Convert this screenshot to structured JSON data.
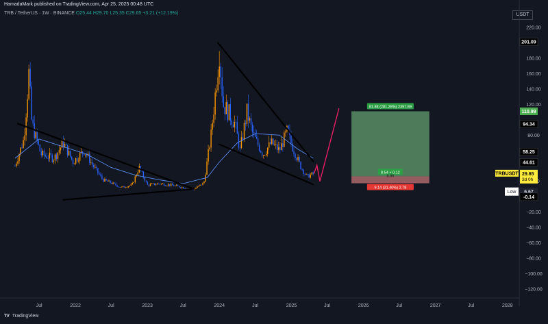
{
  "header": {
    "publish_line": "HamadaMark published on TradingView.com, Apr 25, 2025 00:48 UTC",
    "symbol": "TRB / TetherUS · 1W · BINANCE",
    "ohlc": "O25.44 H29.70 L25.35 C29.65 +3.21 (+12.19%)",
    "unit": "USDT"
  },
  "footer": {
    "logo_icon": "tradingview-logo-icon",
    "brand": "TradingView"
  },
  "colors": {
    "background": "#131722",
    "up_candle": "#ff9800",
    "down_candle": "#2962ff",
    "moving_average": "#5b8cf0",
    "trend_lines": "#000000",
    "projection": "#e91e63",
    "profit_zone": "#7fcf8a",
    "loss_zone": "#f08a8a"
  },
  "chart_data": {
    "type": "candlestick",
    "y_axis": {
      "min": -120,
      "max": 220,
      "ticks": [
        220,
        200,
        180,
        160,
        140,
        120,
        100,
        80,
        60,
        40,
        20,
        0,
        -20,
        -40,
        -60,
        -80,
        -100,
        -120
      ],
      "tick_labels": [
        "220.00",
        "",
        "180.00",
        "160.00",
        "140.00",
        "120.00",
        "",
        "80.00",
        "",
        "",
        "20.00",
        "",
        "−20.00",
        "−40.00",
        "−60.00",
        "−80.00",
        "−100.00",
        "−120.00"
      ]
    },
    "x_axis": {
      "labels": [
        {
          "text": "Jul",
          "date": "2021-07-01"
        },
        {
          "text": "2022",
          "date": "2022-01-01"
        },
        {
          "text": "Jul",
          "date": "2022-07-01"
        },
        {
          "text": "2023",
          "date": "2023-01-01"
        },
        {
          "text": "Jul",
          "date": "2023-07-01"
        },
        {
          "text": "2024",
          "date": "2024-01-01"
        },
        {
          "text": "Jul",
          "date": "2024-07-01"
        },
        {
          "text": "2025",
          "date": "2025-01-01"
        },
        {
          "text": "Jul",
          "date": "2025-07-01"
        },
        {
          "text": "2026",
          "date": "2026-01-01"
        },
        {
          "text": "Jul",
          "date": "2026-07-01"
        },
        {
          "text": "2027",
          "date": "2027-01-01"
        },
        {
          "text": "Jul",
          "date": "2027-07-01"
        },
        {
          "text": "2028",
          "date": "2028-01-01"
        }
      ]
    },
    "price_path": [
      [
        "2021-03-01",
        40
      ],
      [
        "2021-04-15",
        75
      ],
      [
        "2021-05-10",
        160
      ],
      [
        "2021-05-25",
        95
      ],
      [
        "2021-07-10",
        55
      ],
      [
        "2021-09-15",
        50
      ],
      [
        "2021-11-01",
        70
      ],
      [
        "2021-12-20",
        45
      ],
      [
        "2022-02-15",
        60
      ],
      [
        "2022-04-01",
        40
      ],
      [
        "2022-05-20",
        22
      ],
      [
        "2022-07-01",
        18
      ],
      [
        "2022-08-20",
        12
      ],
      [
        "2022-10-15",
        15
      ],
      [
        "2022-11-20",
        38
      ],
      [
        "2023-01-01",
        15
      ],
      [
        "2023-03-01",
        17
      ],
      [
        "2023-05-01",
        15
      ],
      [
        "2023-07-01",
        12
      ],
      [
        "2023-08-20",
        9
      ],
      [
        "2023-10-15",
        18
      ],
      [
        "2023-11-20",
        80
      ],
      [
        "2023-12-10",
        130
      ],
      [
        "2024-01-01",
        190
      ],
      [
        "2024-01-20",
        120
      ],
      [
        "2024-02-15",
        110
      ],
      [
        "2024-03-20",
        95
      ],
      [
        "2024-04-15",
        60
      ],
      [
        "2024-05-20",
        110
      ],
      [
        "2024-06-20",
        80
      ],
      [
        "2024-08-10",
        55
      ],
      [
        "2024-09-20",
        70
      ],
      [
        "2024-11-01",
        60
      ],
      [
        "2024-12-10",
        85
      ],
      [
        "2025-01-01",
        68
      ],
      [
        "2025-02-15",
        40
      ],
      [
        "2025-03-20",
        26
      ],
      [
        "2025-04-21",
        29.65
      ]
    ],
    "moving_average": [
      [
        "2021-03-01",
        50
      ],
      [
        "2021-07-01",
        75
      ],
      [
        "2021-11-01",
        65
      ],
      [
        "2022-03-01",
        55
      ],
      [
        "2022-07-01",
        38
      ],
      [
        "2022-11-01",
        28
      ],
      [
        "2023-03-01",
        22
      ],
      [
        "2023-07-01",
        17
      ],
      [
        "2023-11-01",
        25
      ],
      [
        "2024-01-01",
        45
      ],
      [
        "2024-04-01",
        70
      ],
      [
        "2024-07-01",
        82
      ],
      [
        "2024-11-01",
        80
      ],
      [
        "2025-02-01",
        62
      ],
      [
        "2025-04-21",
        50
      ]
    ],
    "trend_lines": [
      {
        "name": "upper-trendline-1",
        "from": [
          "2021-03-15",
          95
        ],
        "to": [
          "2023-08-25",
          10
        ]
      },
      {
        "name": "lower-trendline-1",
        "from": [
          "2021-11-01",
          -4
        ],
        "to": [
          "2023-08-25",
          10
        ]
      },
      {
        "name": "upper-trendline-2",
        "from": [
          "2023-12-25",
          200
        ],
        "to": [
          "2025-04-21",
          46
        ]
      },
      {
        "name": "lower-trendline-2",
        "from": [
          "2024-01-01",
          68
        ],
        "to": [
          "2025-04-21",
          16
        ]
      }
    ],
    "projection": [
      [
        "2025-04-25",
        30
      ],
      [
        "2025-05-10",
        41
      ],
      [
        "2025-05-25",
        20
      ],
      [
        "2025-08-30",
        115
      ]
    ],
    "position": {
      "start": "2025-11-01",
      "end": "2026-12-01",
      "entry": 26.5,
      "target": 110.99,
      "stop": 17.5,
      "target_label": "81.88 (281.28%) 2397.89",
      "entry_label": "8.54 + 0.12",
      "entry_sub_label": "8.96",
      "stop_label": "9.14 (31.40%) 2.78"
    },
    "price_tags": [
      {
        "value": 201.09,
        "text": "201.09",
        "style": "black"
      },
      {
        "value": 110.99,
        "text": "110.99",
        "style": "green"
      },
      {
        "value": 94.34,
        "text": "94.34",
        "style": "black"
      },
      {
        "value": 58.25,
        "text": "58.25",
        "style": "black"
      },
      {
        "value": 44.61,
        "text": "44.61",
        "style": "black"
      },
      {
        "value": 29.65,
        "text": "29.65",
        "style": "yellow"
      },
      {
        "value": 6.67,
        "text": "6.67",
        "style": "dark"
      },
      {
        "value": -0.14,
        "text": "-0.14",
        "style": "black"
      }
    ],
    "current": {
      "symbol": "TRBUSDT",
      "price": "29.65",
      "countdown": "3d 0h"
    },
    "low_label": "Low"
  }
}
